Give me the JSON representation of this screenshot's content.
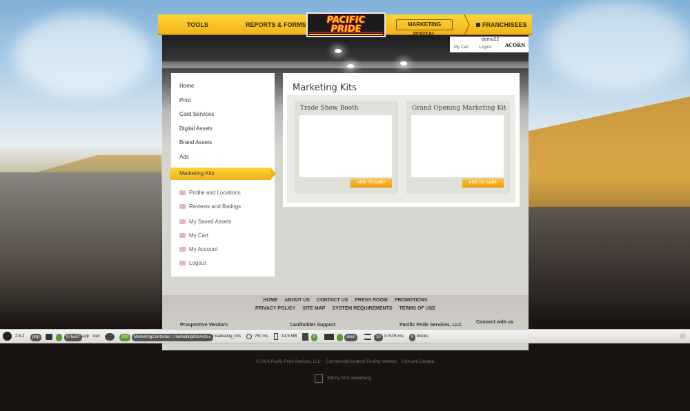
{
  "nav": {
    "tools": "TOOLS",
    "reports": "REPORTS & FORMS",
    "portal": "MARKETING PORTAL",
    "franchisees": "FRANCHISEES"
  },
  "logo": {
    "line1": "PACIFIC",
    "line2": "PRIDE"
  },
  "user": {
    "name": "demo22",
    "cart": "My Cart",
    "logout": "Logout",
    "acorn": "ACORN"
  },
  "sidebar": {
    "items": [
      "Home",
      "Print",
      "Card Services",
      "Digital Assets",
      "Brand Assets",
      "Ads",
      "Marketing Kits"
    ],
    "account": [
      "Profile and Locations",
      "Reviews and Ratings",
      "My Saved Assets",
      "My Cart",
      "My Account",
      "Logout"
    ]
  },
  "main": {
    "title": "Marketing Kits",
    "kits": [
      {
        "name": "Trade Show Booth",
        "button": "ADD TO CART"
      },
      {
        "name": "Grand Opening Marketing Kit",
        "button": "ADD TO CART"
      }
    ]
  },
  "footer": {
    "row1": [
      "HOME",
      "ABOUT US",
      "CONTACT US",
      "PRESS ROOM",
      "PROMOTIONS"
    ],
    "row2": [
      "PRIVACY POLICY",
      "SITE MAP",
      "SYSTEM REQUIREMENTS",
      "TERMS OF USE"
    ],
    "col1": "Prospective Vendors",
    "col2": "Cardholder Support",
    "col3": "Pacific Pride Services, LLC",
    "connect": "Connect with us"
  },
  "toolbar": {
    "version": "2.5.2",
    "php": "php",
    "token": "976a87",
    "app": "app",
    "env": "dev",
    "status": "200",
    "controller": "MarketingController :: marketingKitsAction",
    "route": "on marketing_kits",
    "time": "760 ms",
    "memory": "14.5 MB",
    "forms": "0",
    "user": "anon",
    "queries": "10",
    "query_time": "in 5.05 ms",
    "blocks": "0",
    "blocks_label": "blocks"
  },
  "bottom": {
    "copyright": "© 2014 Pacific Pride Services, LLC",
    "network": "Commercial Cardlock Fueling Network",
    "region": "USA and Canada",
    "credit": "Site by DHX Advertising"
  },
  "colors": {
    "accent": "#f0b51a",
    "button": "#f09a0a",
    "logo_bg": "#1b1b1b",
    "logo_text": "#ffd200"
  }
}
